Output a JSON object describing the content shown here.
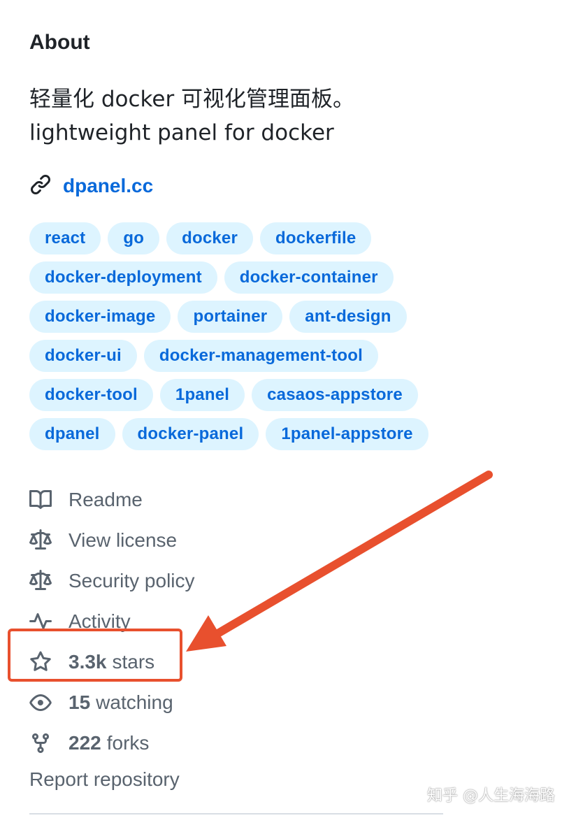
{
  "about": {
    "title": "About",
    "description_line1": "轻量化 docker 可视化管理面板。",
    "description_line2": "lightweight panel for docker",
    "website": "dpanel.cc"
  },
  "topics": [
    "react",
    "go",
    "docker",
    "dockerfile",
    "docker-deployment",
    "docker-container",
    "docker-image",
    "portainer",
    "ant-design",
    "docker-ui",
    "docker-management-tool",
    "docker-tool",
    "1panel",
    "casaos-appstore",
    "dpanel",
    "docker-panel",
    "1panel-appstore"
  ],
  "meta": {
    "readme": "Readme",
    "license": "View license",
    "security": "Security policy",
    "activity": "Activity",
    "stars_count": "3.3k",
    "stars_label": "stars",
    "watching_count": "15",
    "watching_label": "watching",
    "forks_count": "222",
    "forks_label": "forks"
  },
  "report": "Report repository",
  "watermark": "知乎 @人生海海路",
  "colors": {
    "link": "#0969da",
    "topic_bg": "#ddf4ff",
    "muted": "#59636e",
    "annotation": "#e8502e"
  }
}
